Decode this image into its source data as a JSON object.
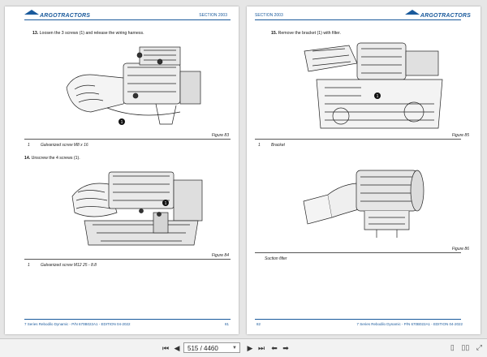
{
  "left_page": {
    "logo": "ARGOTRACTORS",
    "section": "SECTION 2003",
    "step13": {
      "num": "13.",
      "text": "Loosen the 3 screws (1) and release the wiring harness."
    },
    "figure83": {
      "caption": "Figure 83",
      "legend_num": "1",
      "legend_text": "Galvanized screw M8 x 16",
      "callout": "1"
    },
    "step14": {
      "num": "14.",
      "text": "Unscrew the 4 screws (1)."
    },
    "figure84": {
      "caption": "Figure 84",
      "legend_num": "1",
      "legend_text": "Galvanized screw M12 25 - 8.8",
      "callout": "1"
    },
    "footer_text": "7 Series Rebodilo Dynamic - P/N 670B022A1 - EDITION 04-2022",
    "page_number": "81"
  },
  "right_page": {
    "logo": "ARGOTRACTORS",
    "section": "SECTION 2003",
    "step15": {
      "num": "15.",
      "text": "Remove the bracket (1) with filter."
    },
    "figure85": {
      "caption": "Figure 85",
      "legend_num": "1",
      "legend_text": "Bracket",
      "callout": "1"
    },
    "figure86": {
      "caption": "Figure 86",
      "legend_text": "Suction filter"
    },
    "footer_text": "7 Series Rebodilo Dynamic - P/N 670B022A1 - EDITION 04-2022",
    "page_number": "82"
  },
  "toolbar": {
    "page_indicator": "515 / 4460",
    "icons": [
      "first-page-icon",
      "previous-page-icon",
      "next-page-icon",
      "last-page-icon",
      "back-icon",
      "forward-icon",
      "single-page-icon",
      "two-page-icon",
      "zoom-icon"
    ]
  }
}
